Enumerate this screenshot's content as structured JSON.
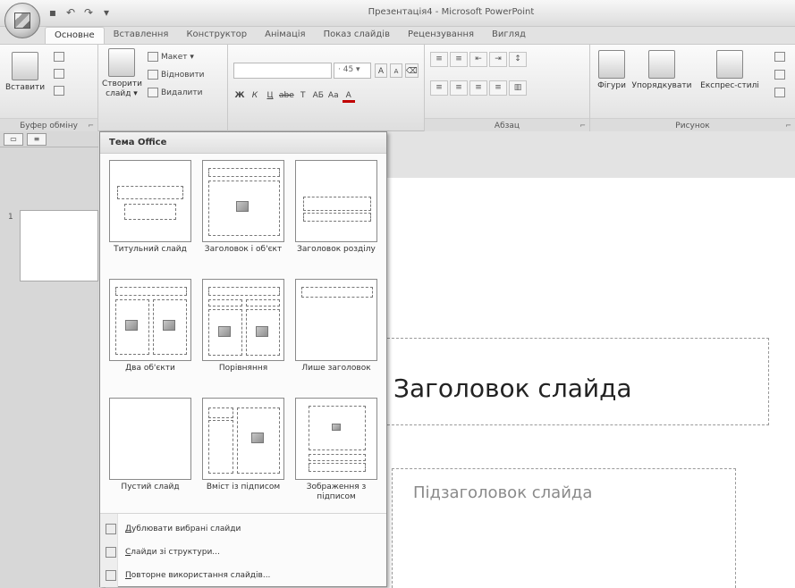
{
  "window": {
    "title": "Презентація4 - Microsoft PowerPoint"
  },
  "qat": {
    "icons": [
      "save-icon",
      "undo-icon",
      "redo-icon",
      "customize-icon"
    ]
  },
  "tabs": [
    {
      "label": "Основне",
      "active": true
    },
    {
      "label": "Вставлення"
    },
    {
      "label": "Конструктор"
    },
    {
      "label": "Анімація"
    },
    {
      "label": "Показ слайдів"
    },
    {
      "label": "Рецензування"
    },
    {
      "label": "Вигляд"
    }
  ],
  "ribbon": {
    "clipboard": {
      "paste_label": "Вставити",
      "group_label": "Буфер обміну"
    },
    "slides": {
      "new_slide_label": "Створити слайд",
      "new_slide_line1": "Створити",
      "new_slide_line2": "слайд ▾",
      "layout_label": "Макет ▾",
      "reset_label": "Відновити",
      "delete_label": "Видалити"
    },
    "font": {
      "font_name": "",
      "font_size": "45",
      "bold": "Ж",
      "italic": "К",
      "underline": "Ц",
      "strike": "abe",
      "shadow": "Т",
      "spacing": "АБ",
      "case": "Aa",
      "color": "А",
      "grow": "A",
      "shrink": "A"
    },
    "paragraph": {
      "group_label": "Абзац"
    },
    "drawing": {
      "shapes_label": "Фігури",
      "arrange_label": "Упорядкувати",
      "styles_label": "Експрес-стилі",
      "group_label": "Рисунок"
    }
  },
  "gallery": {
    "header": "Тема Office",
    "layouts": [
      {
        "label": "Титульний слайд"
      },
      {
        "label": "Заголовок і об'єкт"
      },
      {
        "label": "Заголовок розділу"
      },
      {
        "label": "Два об'єкти"
      },
      {
        "label": "Порівняння"
      },
      {
        "label": "Лише заголовок"
      },
      {
        "label": "Пустий слайд"
      },
      {
        "label": "Вміст із підписом"
      },
      {
        "label": "Зображення з підписом"
      }
    ],
    "menu": [
      {
        "label": "Дублювати вибрані слайди",
        "underline": "Д",
        "rest": "ублювати вибрані слайди"
      },
      {
        "label": "Слайди зі структури...",
        "underline": "С",
        "rest": "лайди зі структури..."
      },
      {
        "label": "Повторне використання слайдів...",
        "underline": "П",
        "rest": "овторне використання слайдів..."
      }
    ]
  },
  "slide_panel": {
    "slide_number": "1"
  },
  "slide": {
    "title_placeholder": "Заголовок слайда",
    "subtitle_placeholder": "Підзаголовок слайда"
  }
}
